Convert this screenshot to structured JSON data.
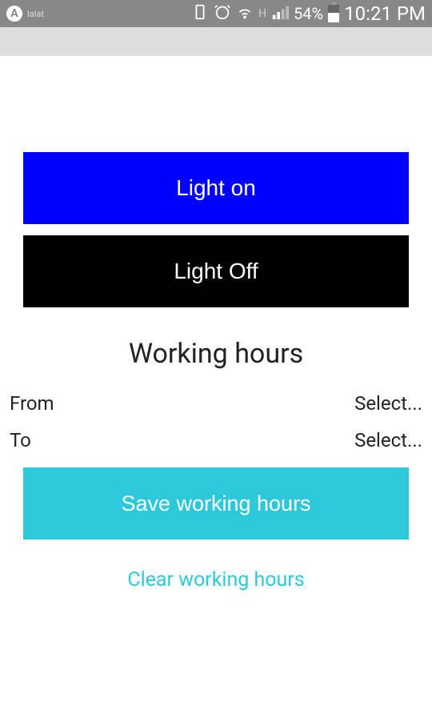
{
  "statusBar": {
    "carrier": "lalat",
    "networkIndicator": "H",
    "batteryPercent": "54%",
    "time": "10:21 PM"
  },
  "buttons": {
    "lightOn": "Light on",
    "lightOff": "Light Off",
    "save": "Save working hours",
    "clear": "Clear working hours"
  },
  "section": {
    "title": "Working hours"
  },
  "timeFields": {
    "fromLabel": "From",
    "fromValue": "Select...",
    "toLabel": "To",
    "toValue": "Select..."
  }
}
